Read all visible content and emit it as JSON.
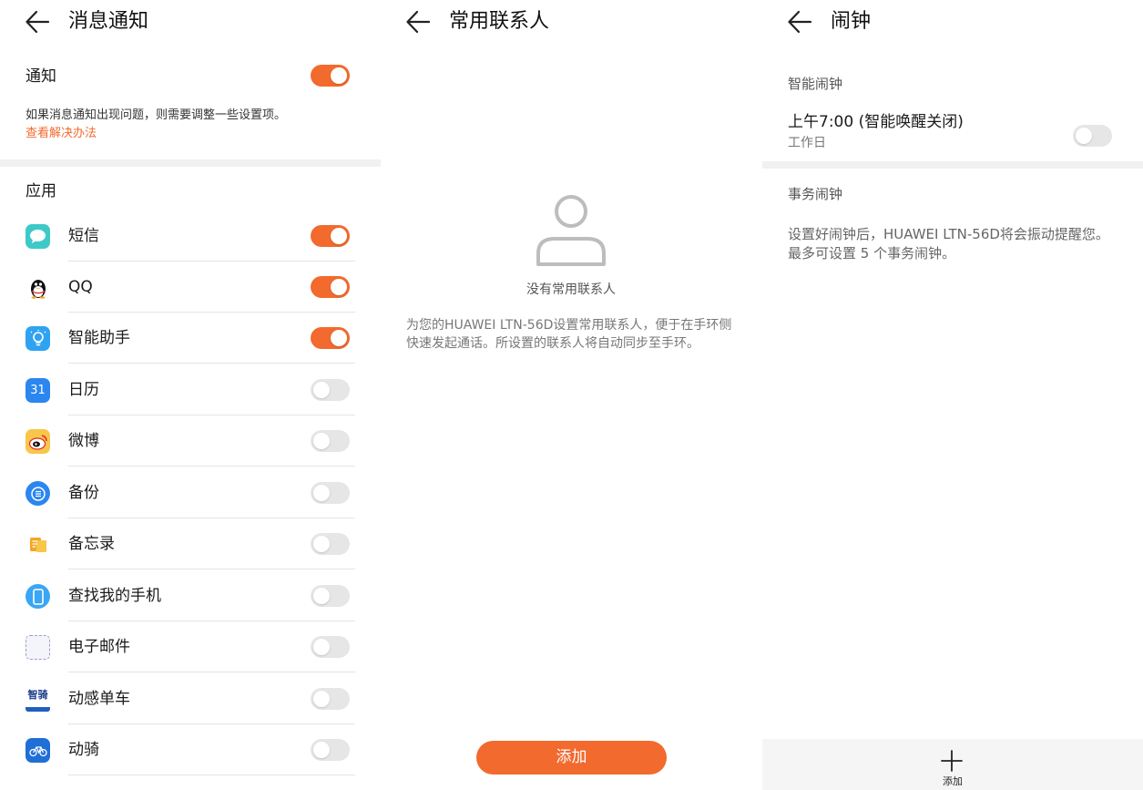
{
  "colors": {
    "accent": "#f26a2e",
    "toggle_off": "#e6e6e6"
  },
  "notifications_panel": {
    "title": "消息通知",
    "notify_label": "通知",
    "notify_on": true,
    "description": "如果消息通知出现问题，则需要调整一些设置项。",
    "help_link": "查看解决办法",
    "section_title": "应用",
    "apps": [
      {
        "name": "短信",
        "icon": "sms-icon",
        "on": true
      },
      {
        "name": "QQ",
        "icon": "qq-penguin-icon",
        "on": true
      },
      {
        "name": "智能助手",
        "icon": "smart-assistant-icon",
        "on": true
      },
      {
        "name": "日历",
        "icon": "calendar-icon",
        "icon_text": "31",
        "on": false
      },
      {
        "name": "微博",
        "icon": "weibo-icon",
        "on": false
      },
      {
        "name": "备份",
        "icon": "backup-icon",
        "on": false
      },
      {
        "name": "备忘录",
        "icon": "memo-icon",
        "on": false
      },
      {
        "name": "查找我的手机",
        "icon": "find-phone-icon",
        "on": false
      },
      {
        "name": "电子邮件",
        "icon": "email-icon",
        "on": false
      },
      {
        "name": "动感单车",
        "icon": "spin-bike-icon",
        "icon_text": "智骑",
        "on": false
      },
      {
        "name": "动骑",
        "icon": "bicycle-icon",
        "on": false
      }
    ]
  },
  "contacts_panel": {
    "title": "常用联系人",
    "empty_icon": "person-icon",
    "empty_text": "没有常用联系人",
    "description": "为您的HUAWEI LTN-56D设置常用联系人，便于在手环侧快速发起通话。所设置的联系人将自动同步至手环。",
    "add_button": "添加"
  },
  "alarm_panel": {
    "title": "闹钟",
    "smart_section": "智能闹钟",
    "smart_alarm_time": "上午7:00 (智能唤醒关闭)",
    "smart_alarm_repeat": "工作日",
    "smart_alarm_on": false,
    "event_section": "事务闹钟",
    "event_description": "设置好闹钟后，HUAWEI LTN-56D将会振动提醒您。最多可设置 5 个事务闹钟。",
    "add_label": "添加"
  }
}
